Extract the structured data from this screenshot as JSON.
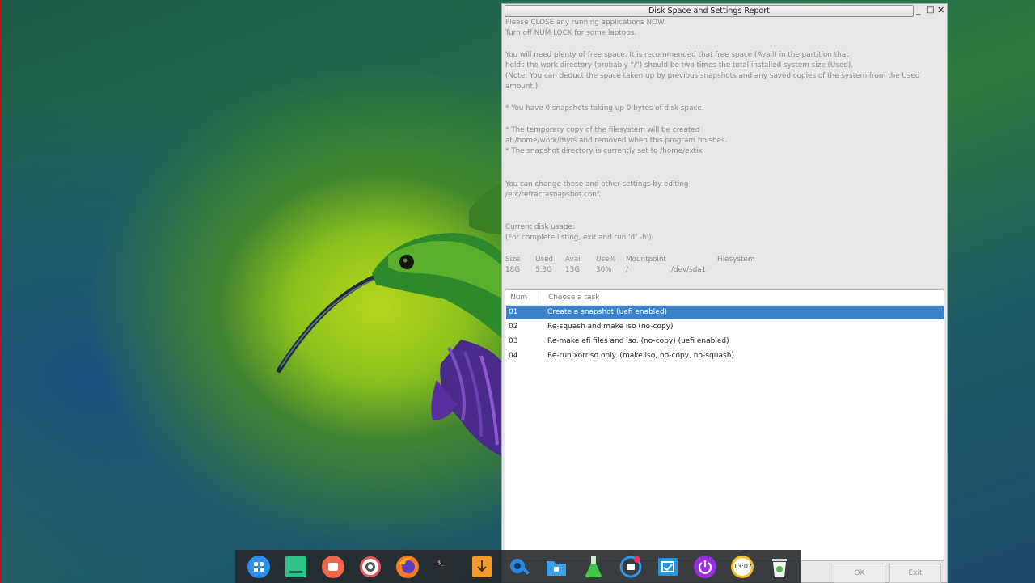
{
  "window": {
    "title": "Disk Space and Settings Report",
    "minimize_glyph": "_",
    "maximize_glyph": "□",
    "close_glyph": "✕"
  },
  "report": {
    "lines": [
      "Please CLOSE any running applications NOW.",
      "Turn off NUM LOCK for some laptops.",
      "",
      "You will need plenty of free space. It is recommended that free space (Avail) in the partition that",
      "holds the work directory (probably \"/\") should be two times the total installed system size (Used).",
      "(Note: You can deduct the space taken up by previous snapshots and any saved copies of the system from the Used",
      "amount.)",
      "",
      "* You have 0 snapshots taking up 0 bytes of disk space.",
      "",
      "* The temporary copy of the filesystem will be created",
      "at /home/work/myfs and removed when this program finishes.",
      "* The snapshot directory is currently set to /home/extix",
      "",
      "",
      "You can change these and other settings by editing",
      "/etc/refractasnapshot.conf.",
      "",
      "",
      "Current disk usage:",
      "(For complete listing, exit and run 'df -h')"
    ],
    "disk_headers": [
      "Size",
      "Used",
      "Avail",
      "Use%",
      "Mountpoint",
      "Filesystem"
    ],
    "disk_values": [
      "18G",
      "5.3G",
      "13G",
      "30%",
      "/",
      "/dev/sda1"
    ]
  },
  "tasks": {
    "columns": [
      "Num",
      "Choose a task"
    ],
    "rows": [
      {
        "num": "01",
        "label": "Create a snapshot (uefi enabled)",
        "selected": true
      },
      {
        "num": "02",
        "label": "Re-squash and make iso (no-copy)",
        "selected": false
      },
      {
        "num": "03",
        "label": "Re-make efi files and iso. (no-copy) (uefi enabled)",
        "selected": false
      },
      {
        "num": "04",
        "label": "Re-run xorriso only. (make iso, no-copy, no-squash)",
        "selected": false
      }
    ],
    "selection_color": "#3d82c6"
  },
  "buttons": {
    "ok": "OK",
    "exit": "Exit"
  },
  "dock": {
    "icons": [
      "launcher-icon",
      "file-manager-icon",
      "screen-recorder-icon",
      "settings-icon",
      "firefox-icon",
      "terminal-icon",
      "downloader-icon",
      "system-tools-icon",
      "folder-icon",
      "lab-flask-icon",
      "camera-icon",
      "screenshot-icon",
      "power-icon",
      "clock-icon",
      "trash-icon"
    ],
    "clock_text": "13:07"
  }
}
